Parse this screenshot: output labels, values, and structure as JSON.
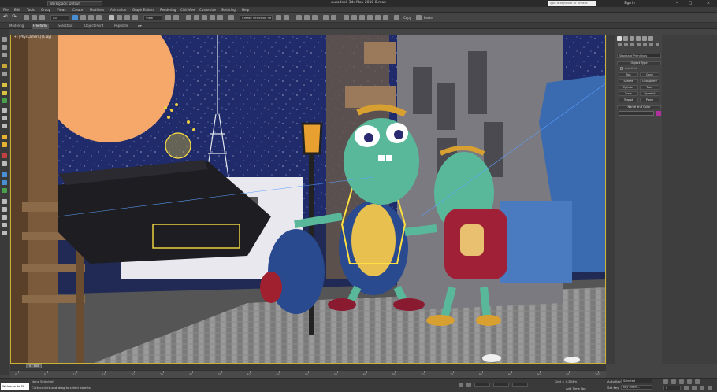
{
  "titlebar": {
    "workspace": "Workspace: Default",
    "title": "Autodesk 3ds Max 2018     0.max",
    "search_placeholder": "Type a keyword or phrase",
    "signin": "Sign In",
    "min": "–",
    "max": "□",
    "close": "×"
  },
  "menus": [
    "File",
    "Edit",
    "Tools",
    "Group",
    "Views",
    "Create",
    "Modifiers",
    "Animation",
    "Graph Editors",
    "Rendering",
    "Civil View",
    "Customize",
    "Scripting",
    "Help"
  ],
  "toolbar": {
    "undo": "↶",
    "redo": "↷",
    "filter_label": "All",
    "refcoord_label": "View",
    "selset_label": "Create Selection Se",
    "copy_label": "Copy",
    "paste_label": "Paste"
  },
  "ribbon_tabs": [
    "Modeling",
    "Freeform",
    "Selection",
    "Object Paint",
    "Populate"
  ],
  "viewport": {
    "label": "[+] [PhysCamera] [Clay]"
  },
  "cmdpanel": {
    "category": "Standard Primitives",
    "object_type": "Object Type",
    "autogrid": "AutoGrid",
    "buttons": [
      "Box",
      "Cone",
      "Sphere",
      "GeoSphere",
      "Cylinder",
      "Tube",
      "Torus",
      "Pyramid",
      "Teapot",
      "Plane"
    ],
    "name_color": "Name and Color"
  },
  "timeline": {
    "slider": "0 / 100",
    "ticks": [
      "0",
      "5",
      "10",
      "15",
      "20",
      "25",
      "30",
      "35",
      "40",
      "45",
      "50",
      "55",
      "60",
      "65",
      "70",
      "75",
      "80",
      "85",
      "90",
      "95",
      "100"
    ]
  },
  "status": {
    "maxscript": "Welcome to M",
    "selection": "None Selected",
    "prompt": "Click or click-and-drag to select objects",
    "grid": "Grid = 0.254m",
    "addtimetag": "Add Time Tag",
    "autokey": "Auto Key",
    "autokey_value": "Selected",
    "setkey": "Set Key",
    "keyfilters": "Key Filters...",
    "frame": "0"
  }
}
